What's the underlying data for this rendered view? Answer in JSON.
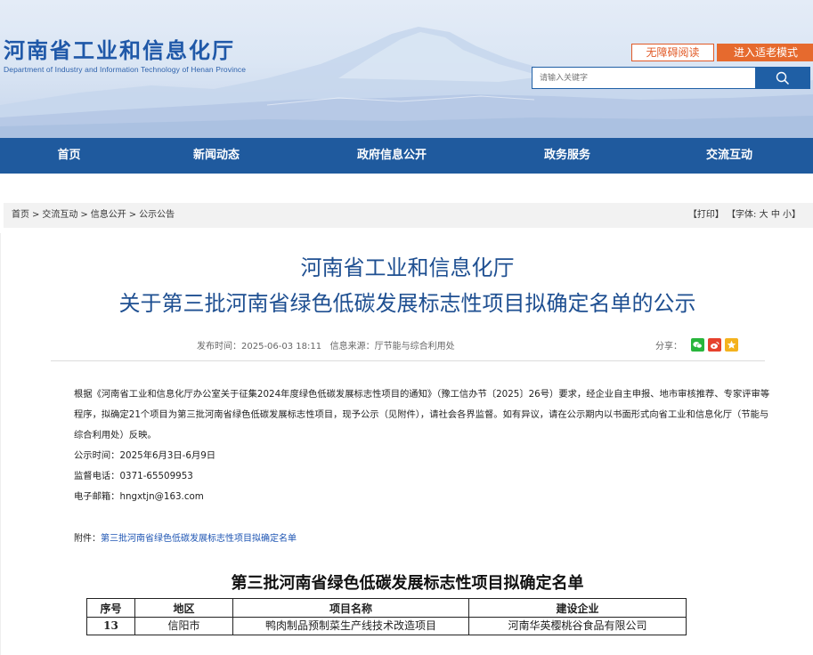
{
  "header": {
    "title": "河南省工业和信息化厅",
    "subtitle": "Department of Industry and Information Technology of Henan Province",
    "accessible_label": "无障碍阅读",
    "elderly_mode_label": "进入适老模式",
    "search_placeholder": "请输入关键字"
  },
  "nav": {
    "items": [
      "首页",
      "新闻动态",
      "政府信息公开",
      "政务服务",
      "交流互动"
    ]
  },
  "breadcrumb": {
    "items": [
      "首页",
      "交流互动",
      "信息公开",
      "公示公告"
    ],
    "separator": ">"
  },
  "tools": {
    "print": "【打印】",
    "font_prefix": "【字体:",
    "font_large": "大",
    "font_medium": "中",
    "font_small": "小",
    "font_suffix": "】"
  },
  "article": {
    "title_line1": "河南省工业和信息化厅",
    "title_line2": "关于第三批河南省绿色低碳发展标志性项目拟确定名单的公示",
    "publish_label": "发布时间：",
    "publish_time": "2025-06-03 18:11",
    "source_label": "信息来源：",
    "source": "厅节能与综合利用处",
    "share_label": "分享：",
    "paragraph": "根据《河南省工业和信息化厅办公室关于征集2024年度绿色低碳发展标志性项目的通知》（豫工信办节〔2025〕26号）要求，经企业自主申报、地市审核推荐、专家评审等程序，拟确定21个项目为第三批河南省绿色低碳发展标志性项目，现予公示（见附件），请社会各界监督。如有异议，请在公示期内以书面形式向省工业和信息化厅（节能与综合利用处）反映。",
    "period": "公示时间：2025年6月3日-6月9日",
    "phone": "监督电话：0371-65509953",
    "email": "电子邮箱：hngxtjn@163.com",
    "attachment_label": "附件：",
    "attachment_link": "第三批河南省绿色低碳发展标志性项目拟确定名单"
  },
  "document": {
    "title": "第三批河南省绿色低碳发展标志性项目拟确定名单",
    "columns": [
      "序号",
      "地区",
      "项目名称",
      "建设企业"
    ],
    "rows": [
      [
        "13",
        "信阳市",
        "鸭肉制品预制菜生产线技术改造项目",
        "河南华英樱桃谷食品有限公司"
      ]
    ]
  },
  "colors": {
    "brand_blue": "#1f58a8",
    "nav_blue": "#1f5a9e",
    "accent_orange": "#e66a2e",
    "link_blue": "#1e55b3"
  }
}
